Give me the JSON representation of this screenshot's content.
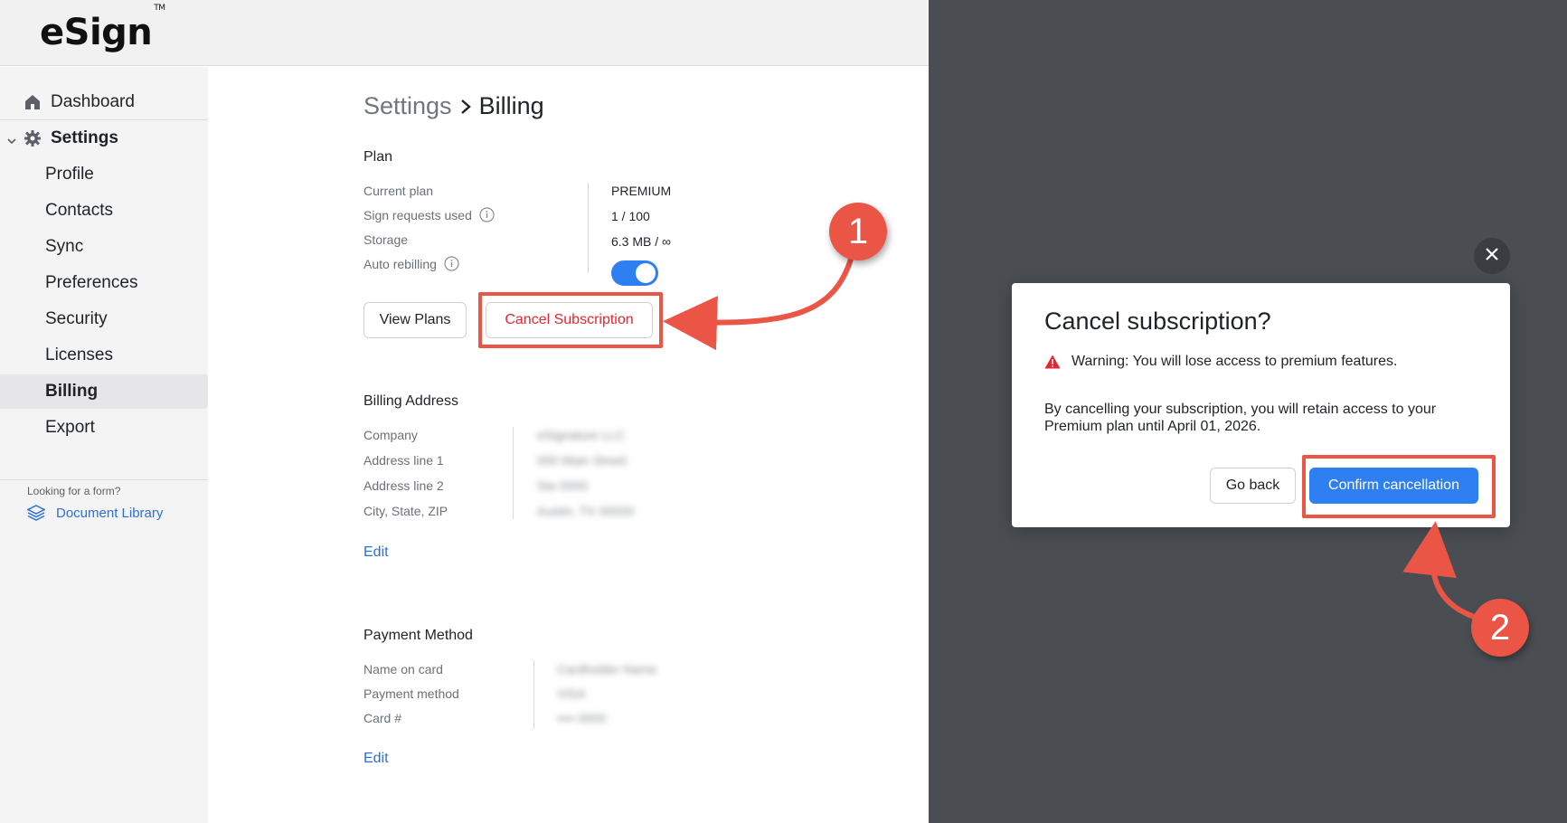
{
  "app": {
    "logo_text": "eSign",
    "logo_tm": "TM"
  },
  "sidebar": {
    "items": [
      {
        "label": "Dashboard",
        "icon": "home-icon"
      },
      {
        "label": "Settings",
        "icon": "gear-icon"
      },
      {
        "label": "Profile"
      },
      {
        "label": "Contacts"
      },
      {
        "label": "Sync"
      },
      {
        "label": "Preferences"
      },
      {
        "label": "Security"
      },
      {
        "label": "Licenses"
      },
      {
        "label": "Billing",
        "active": true
      },
      {
        "label": "Export"
      }
    ],
    "hint": "Looking for a form?",
    "doc_library_label": "Document Library"
  },
  "breadcrumb": {
    "parent": "Settings",
    "current": "Billing"
  },
  "plan": {
    "title": "Plan",
    "rows": [
      {
        "label": "Current plan",
        "value": "PREMIUM"
      },
      {
        "label": "Sign requests used",
        "value": "1 / 100"
      },
      {
        "label": "Storage",
        "value": "6.3 MB / ∞"
      },
      {
        "label": "Auto rebilling",
        "toggle_on": true
      }
    ],
    "view_plans_label": "View Plans",
    "cancel_label": "Cancel Subscription"
  },
  "billing_address": {
    "title": "Billing Address",
    "rows": [
      {
        "label": "Company",
        "value": "eSignature LLC"
      },
      {
        "label": "Address line 1",
        "value": "000 Main Street"
      },
      {
        "label": "Address line 2",
        "value": "Ste 0000"
      },
      {
        "label": "City, State, ZIP",
        "value": "Austin, TX 00000"
      }
    ],
    "edit_label": "Edit"
  },
  "payment_method": {
    "title": "Payment Method",
    "rows": [
      {
        "label": "Name on card",
        "value": "Cardholder Name"
      },
      {
        "label": "Payment method",
        "value": "VISA"
      },
      {
        "label": "Card #",
        "value": "•••• 0000"
      }
    ],
    "edit_label": "Edit"
  },
  "modal": {
    "title": "Cancel subscription?",
    "warning": "Warning: You will lose access to premium features.",
    "body": "By cancelling your subscription, you will retain access to your Premium plan until April 01, 2026.",
    "go_back_label": "Go back",
    "confirm_label": "Confirm cancellation"
  },
  "annotations": {
    "step1": "1",
    "step2": "2",
    "color": "#ea5546"
  },
  "colors": {
    "accent": "#2d7ff2",
    "danger": "#e3262f",
    "link": "#2d6fd6",
    "overlay": "#4a4e53"
  }
}
